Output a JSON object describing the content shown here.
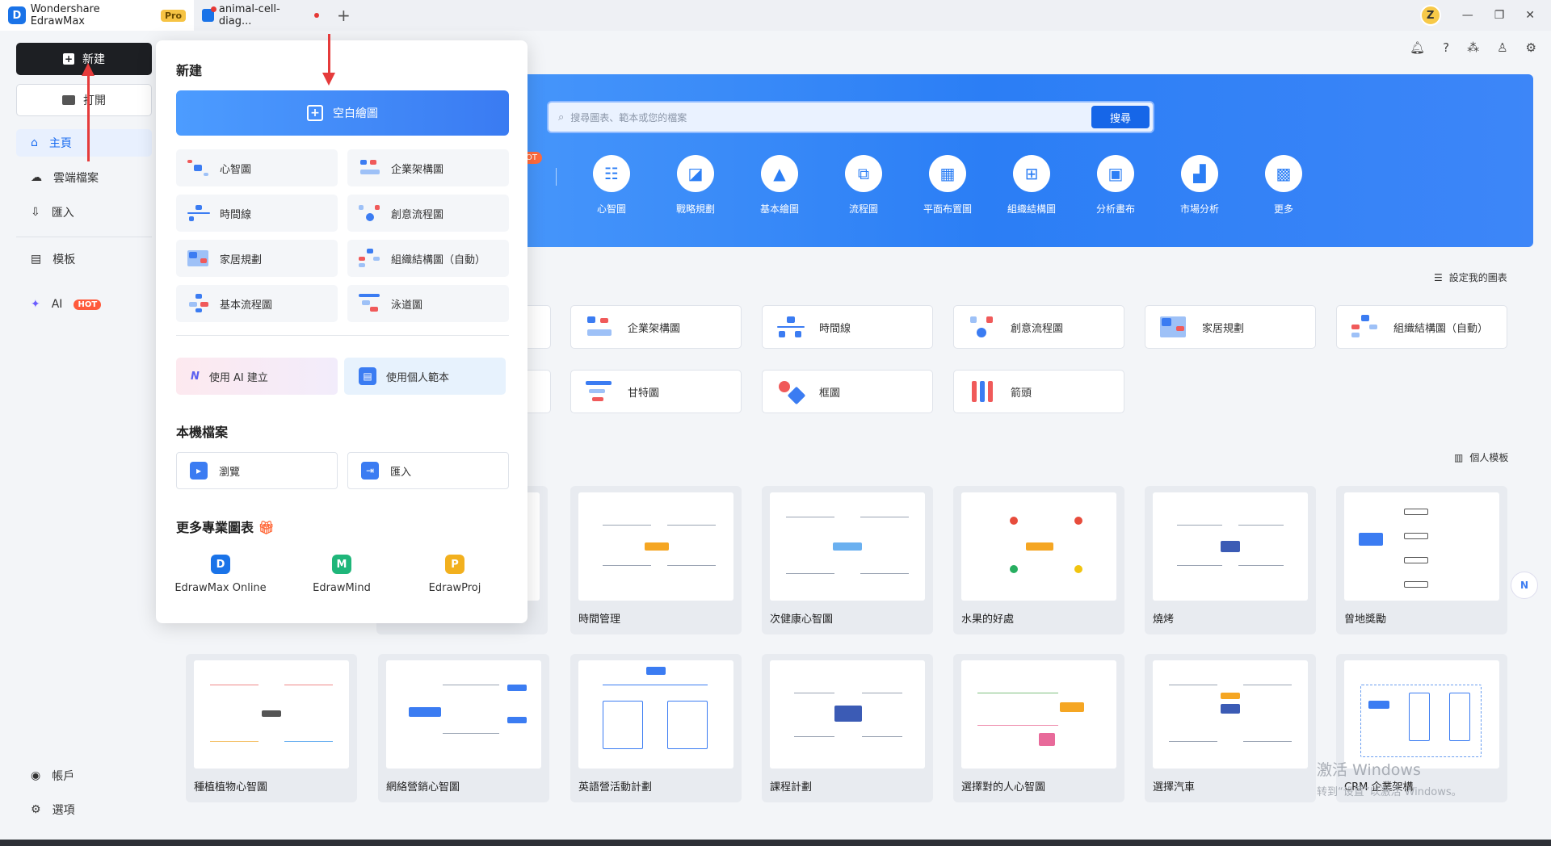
{
  "titlebar": {
    "app_tab": "Wondershare EdrawMax",
    "pro_badge": "Pro",
    "doc_tab": "animal-cell-diag...",
    "avatar_letter": "Z"
  },
  "sidebar": {
    "new_label": "新建",
    "open_label": "打開",
    "items": [
      {
        "label": "主頁",
        "icon": "home-icon"
      },
      {
        "label": "雲端檔案",
        "icon": "cloud-icon"
      },
      {
        "label": "匯入",
        "icon": "import-icon"
      },
      {
        "label": "模板",
        "icon": "template-icon"
      },
      {
        "label": "AI",
        "icon": "ai-sparkle-icon"
      }
    ],
    "ai_hot": "HOT",
    "account": "帳戶",
    "options": "選項"
  },
  "banner": {
    "search_placeholder": "搜尋圖表、範本或您的檔案",
    "search_button": "搜尋",
    "hot_badge": "OT",
    "categories": [
      "心智圖",
      "戰略規劃",
      "基本繪圖",
      "流程圖",
      "平面布置圖",
      "組織結構圖",
      "分析畫布",
      "市場分析",
      "更多"
    ]
  },
  "quick": {
    "set_my_charts": "設定我的圖表",
    "row1": [
      "企業架構圖",
      "時間線",
      "創意流程圖",
      "家居規劃",
      "組織結構圖（自動）"
    ],
    "row2": [
      "甘特圖",
      "框圖",
      "箭頭"
    ],
    "personal_templates": "個人模板"
  },
  "templates": {
    "row1": [
      "時間管理",
      "次健康心智圖",
      "水果的好處",
      "燒烤",
      "曾地獎勵"
    ],
    "row2": [
      "種植植物心智圖",
      "網絡營銷心智圖",
      "英語營活動計劃",
      "課程計劃",
      "選擇對的人心智圖",
      "選擇汽車",
      "CRM 企業架構"
    ]
  },
  "popup": {
    "new_title": "新建",
    "blank": "空白繪圖",
    "items": [
      "心智圖",
      "企業架構圖",
      "時間線",
      "創意流程圖",
      "家居規劃",
      "組織結構圖（自動）",
      "基本流程圖",
      "泳道圖"
    ],
    "ai_create": "使用 AI 建立",
    "personal_template": "使用個人範本",
    "local_title": "本機檔案",
    "browse": "瀏覽",
    "import": "匯入",
    "more_title": "更多專業圖表",
    "products": [
      "EdrawMax Online",
      "EdrawMind",
      "EdrawProj"
    ]
  },
  "watermark": {
    "line1": "激活 Windows",
    "line2": "转到“设置”以激活 Windows。"
  },
  "colors": {
    "accent": "#1a6cf0",
    "banner": "#2b7ef5",
    "annotation_arrow": "#e53b3b"
  }
}
